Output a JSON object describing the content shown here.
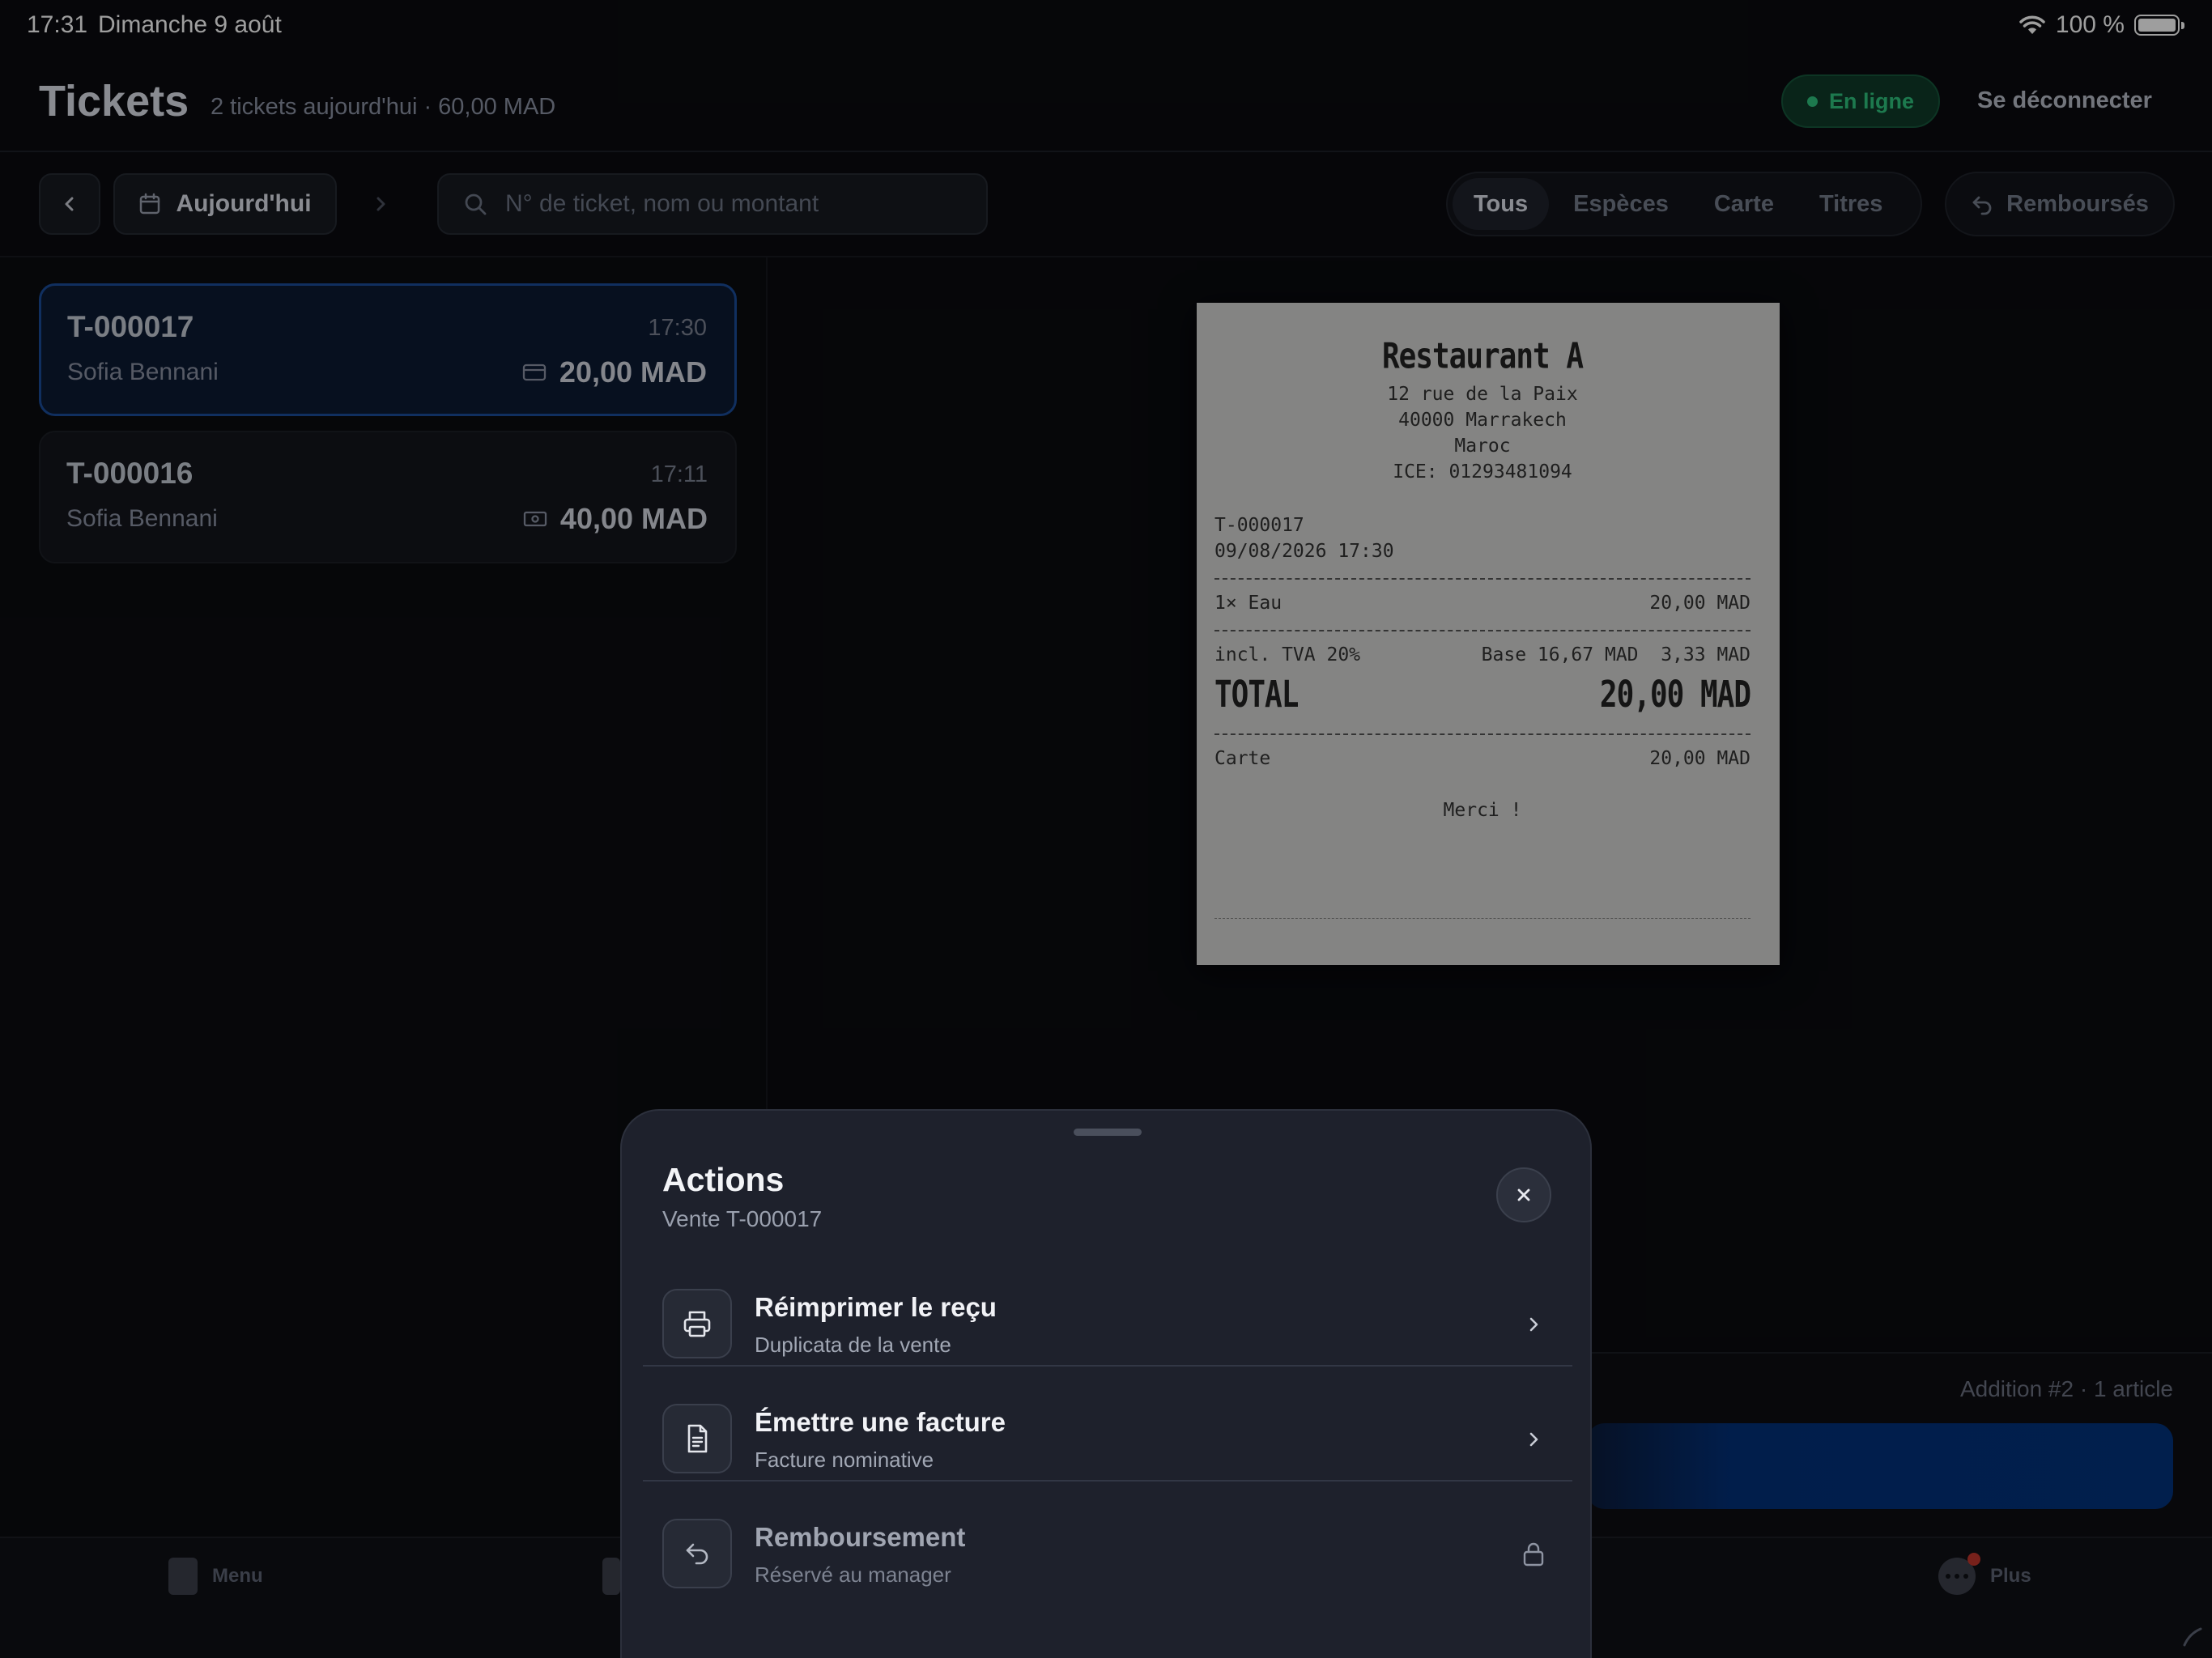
{
  "status_bar": {
    "time": "17:31",
    "date": "Dimanche 9 août",
    "battery": "100 %"
  },
  "header": {
    "title": "Tickets",
    "subtitle": "2 tickets aujourd'hui · 60,00 MAD",
    "status": "En ligne",
    "logout": "Se déconnecter"
  },
  "toolbar": {
    "date_label": "Aujourd'hui",
    "search_placeholder": "N° de ticket, nom ou montant",
    "filters": [
      "Tous",
      "Espèces",
      "Carte",
      "Titres"
    ],
    "active_filter": "Tous",
    "refunds": "Remboursés"
  },
  "tickets": [
    {
      "id": "T-000017",
      "time": "17:30",
      "name": "Sofia Bennani",
      "amount": "20,00 MAD",
      "method_icon": "card-icon",
      "selected": true
    },
    {
      "id": "T-000016",
      "time": "17:11",
      "name": "Sofia Bennani",
      "amount": "40,00 MAD",
      "method_icon": "cash-icon",
      "selected": false
    }
  ],
  "receipt": {
    "restaurant": "Restaurant A",
    "address1": "12 rue de la Paix",
    "address2": "40000 Marrakech",
    "country": "Maroc",
    "ice": "ICE: 01293481094",
    "ticket_id": "T-000017",
    "datetime": "09/08/2026 17:30",
    "item_label": "1× Eau",
    "item_amount": "20,00 MAD",
    "tax_label": "incl. TVA 20%",
    "tax_detail": "Base 16,67 MAD  3,33 MAD",
    "total_label": "TOTAL",
    "total_amount": "20,00 MAD",
    "payment_label": "Carte",
    "payment_amount": "20,00 MAD",
    "thanks": "Merci !"
  },
  "summary": {
    "addition": "Addition #2 · 1 article"
  },
  "tabbar": {
    "menu": "Menu",
    "more": "Plus"
  },
  "sheet": {
    "title": "Actions",
    "subtitle": "Vente T-000017",
    "actions": [
      {
        "title": "Réimprimer le reçu",
        "subtitle": "Duplicata de la vente",
        "icon": "printer-icon",
        "enabled": true
      },
      {
        "title": "Émettre une facture",
        "subtitle": "Facture nominative",
        "icon": "document-icon",
        "enabled": true
      },
      {
        "title": "Remboursement",
        "subtitle": "Réservé au manager",
        "icon": "undo-icon",
        "enabled": false
      }
    ]
  },
  "colors": {
    "accent": "#1b4d9a",
    "online": "#2fc47f",
    "sheet": "#1e212c"
  }
}
